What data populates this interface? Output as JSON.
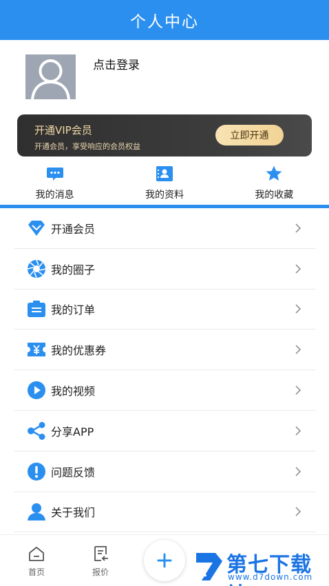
{
  "header": {
    "title": "个人中心"
  },
  "profile": {
    "login_text": "点击登录"
  },
  "vip": {
    "title": "开通VIP会员",
    "subtitle": "开通会员，享受响应的会员权益",
    "button_label": "立即开通"
  },
  "quick_actions": [
    {
      "label": "我的消息",
      "icon": "message-icon"
    },
    {
      "label": "我的资料",
      "icon": "profile-card-icon"
    },
    {
      "label": "我的收藏",
      "icon": "star-icon"
    }
  ],
  "menu": [
    {
      "label": "开通会员",
      "icon": "diamond-icon"
    },
    {
      "label": "我的圈子",
      "icon": "aperture-icon"
    },
    {
      "label": "我的订单",
      "icon": "order-icon"
    },
    {
      "label": "我的优惠券",
      "icon": "coupon-icon"
    },
    {
      "label": "我的视频",
      "icon": "play-icon"
    },
    {
      "label": "分享APP",
      "icon": "share-icon"
    },
    {
      "label": "问题反馈",
      "icon": "exclamation-icon"
    },
    {
      "label": "关于我们",
      "icon": "person-icon"
    }
  ],
  "tabbar": {
    "home": "首页",
    "quote": "报价"
  },
  "watermark": {
    "title": "第七下载站",
    "url": "www.d7down.com"
  },
  "colors": {
    "primary": "#2b8ff0",
    "vip_gold": "#f2d9a6",
    "vip_dark": "#333333"
  }
}
